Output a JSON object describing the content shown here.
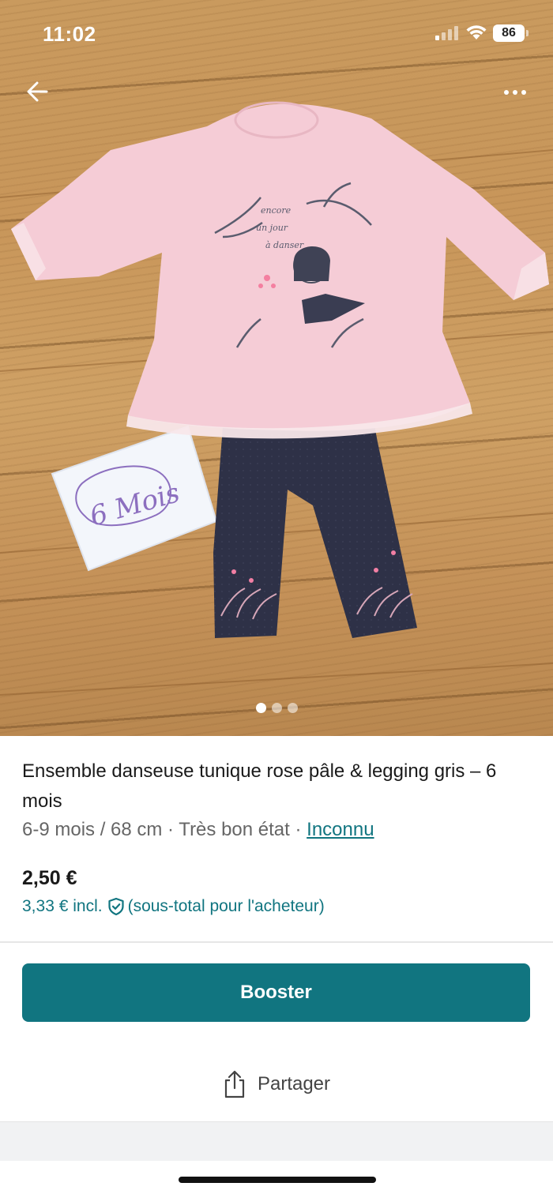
{
  "status_bar": {
    "time": "11:02",
    "battery": "86"
  },
  "gallery": {
    "photo_count": 3,
    "active_index": 0,
    "note_card_text": "6 Mois"
  },
  "item": {
    "title": "Ensemble danseuse tunique rose pâle & legging gris – 6 mois",
    "size": "6-9 mois / 68 cm",
    "separator": " · ",
    "condition": "Très bon état",
    "brand": "Inconnu",
    "price": "2,50 €",
    "buyer_price": "3,33 € incl.",
    "buyer_note": "(sous-total pour l'acheteur)"
  },
  "actions": {
    "booster_label": "Booster",
    "share_label": "Partager"
  },
  "colors": {
    "accent": "#117580",
    "text": "#1a1a1a",
    "muted": "#666666"
  }
}
